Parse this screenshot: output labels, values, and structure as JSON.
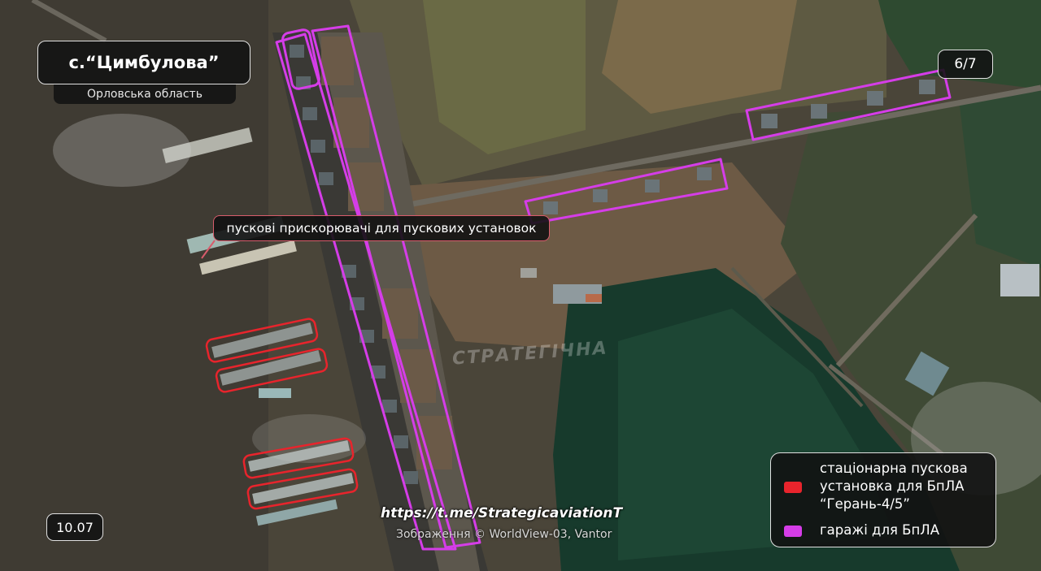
{
  "location": {
    "title": "с.“Цимбулова”",
    "region": "Орловська область"
  },
  "page_indicator": "6/7",
  "date": "10.07",
  "callout_label": "пускові прискорювачі для пускових установок",
  "legend": {
    "launcher_lines": [
      "стаціонарна пускова",
      "установка для БпЛА",
      "“Герань-4/5”"
    ],
    "garage_label": "гаражі для БпЛА"
  },
  "source": {
    "channel_url": "https://t.me/StrategicaviationT",
    "image_credit": "Зображення © WorldView-03, Vantor"
  },
  "watermark": "СТРАТЕГІЧНА",
  "colors": {
    "launcher_outline": "#e8242c",
    "garage_outline": "#d53de8",
    "panel_bg": "#121212"
  }
}
